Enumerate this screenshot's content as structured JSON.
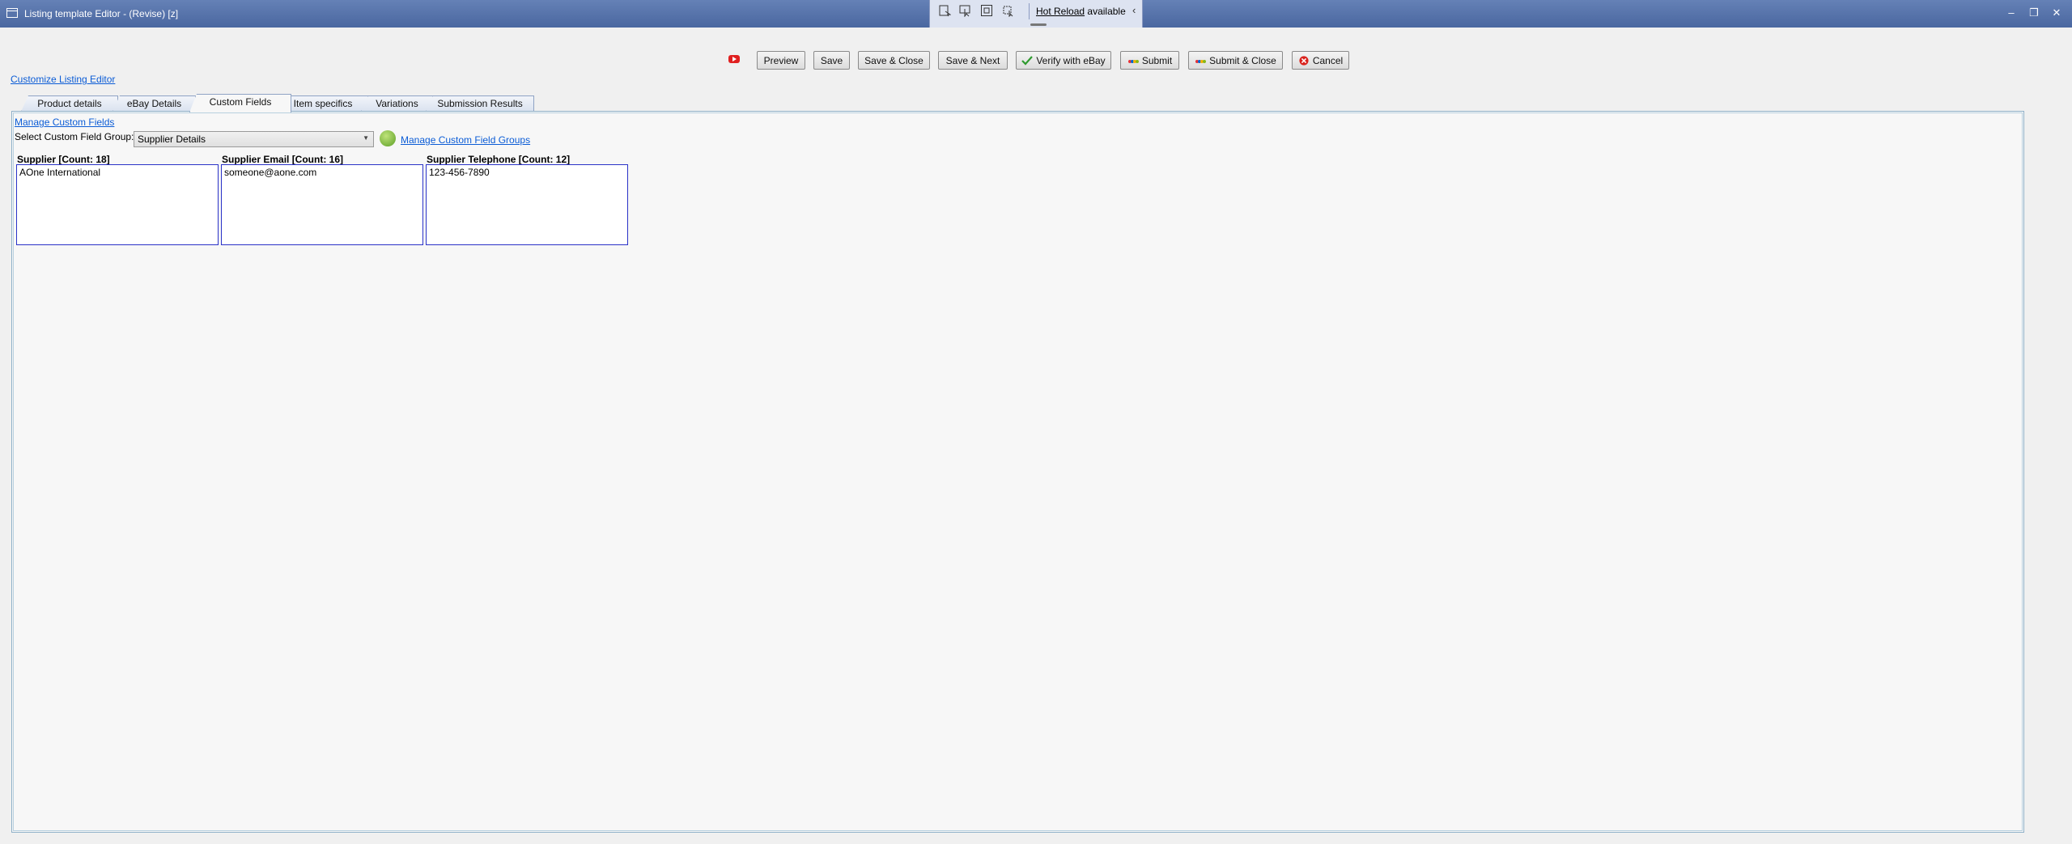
{
  "window": {
    "title": "Listing template Editor - (Revise) [z]",
    "controls": {
      "minimize": "–",
      "restore": "❐",
      "close": "✕"
    }
  },
  "hot_reload": {
    "link": "Hot Reload",
    "status": "available",
    "tools": [
      "inspect-icon",
      "select-element-icon",
      "display-layout-icon",
      "track-focus-icon"
    ]
  },
  "customize_link": "Customize Listing Editor",
  "toolbar": {
    "preview": "Preview",
    "save": "Save",
    "save_close": "Save & Close",
    "save_next": "Save & Next",
    "verify": "Verify with eBay",
    "submit": "Submit",
    "submit_close": "Submit & Close",
    "cancel": "Cancel"
  },
  "tabs": [
    {
      "label": "Product details"
    },
    {
      "label": "eBay Details"
    },
    {
      "label": "Custom Fields",
      "active": true
    },
    {
      "label": "Item specifics"
    },
    {
      "label": "Variations"
    },
    {
      "label": "Submission Results"
    }
  ],
  "custom_fields": {
    "manage_fields_link": "Manage Custom Fields",
    "group_label": "Select Custom Field Group:",
    "group_selected": "Supplier Details",
    "manage_groups_link": "Manage Custom Field Groups",
    "fields": [
      {
        "label": "Supplier  [Count: 18]",
        "value": "AOne International"
      },
      {
        "label": "Supplier Email  [Count: 16]",
        "value": "someone@aone.com"
      },
      {
        "label": "Supplier Telephone  [Count: 12]",
        "value": "123-456-7890"
      }
    ]
  },
  "colors": {
    "title_bar": "#4a67a0",
    "link": "#0b5cd6",
    "field_border": "#2a32c8"
  }
}
